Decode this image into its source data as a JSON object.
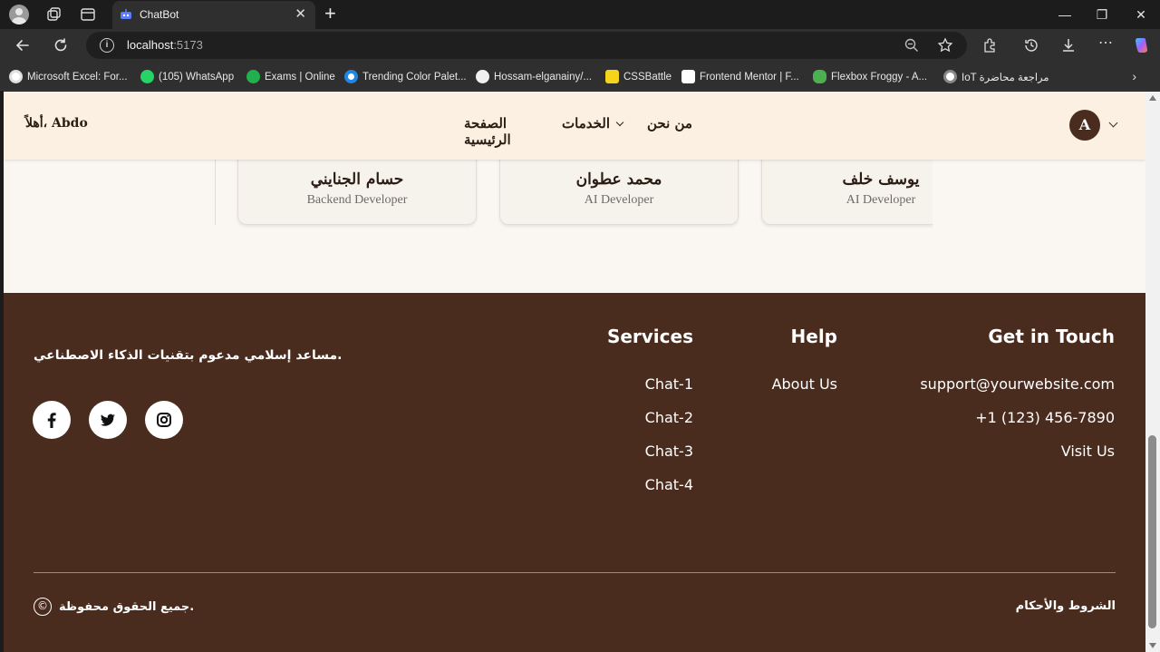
{
  "browser": {
    "tab_title": "ChatBot",
    "url_host": "localhost",
    "url_port": ":5173",
    "bookmarks": [
      "Microsoft Excel: For...",
      "(105) WhatsApp",
      "Exams | Online",
      "Trending Color Palet...",
      "Hossam-elganainy/...",
      "CSSBattle",
      "Frontend Mentor | F...",
      "Flexbox Froggy - A...",
      "IoT مراجعة محاضرة"
    ]
  },
  "navbar": {
    "greeting": "أهلاً، Abdo",
    "links": {
      "home": "الصفحة الرئيسية",
      "services": "الخدمات",
      "about": "من نحن"
    },
    "avatar_letter": "A"
  },
  "team": [
    {
      "name": "حسام الجنايني",
      "role": "Backend Developer"
    },
    {
      "name": "محمد عطوان",
      "role": "AI Developer"
    },
    {
      "name": "يوسف خلف",
      "role": "AI Developer"
    }
  ],
  "footer": {
    "tagline": "مساعد إسلامي مدعوم بتقنيات الذكاء الاصطناعي.",
    "social": [
      "facebook-icon",
      "twitter-icon",
      "instagram-icon"
    ],
    "services": {
      "title": "Services",
      "items": [
        "Chat-1",
        "Chat-2",
        "Chat-3",
        "Chat-4"
      ]
    },
    "help": {
      "title": "Help",
      "items": [
        "About Us"
      ]
    },
    "contact": {
      "title": "Get in Touch",
      "items": [
        "support@yourwebsite.com",
        "+1 (123) 456-7890",
        "Visit Us"
      ]
    },
    "copyright": "جميع الحقوق محفوظة.",
    "terms": "الشروط والأحكام"
  },
  "colors": {
    "footer_bg": "#4a2c1f",
    "navbar_bg": "#fcf0e2",
    "page_bg": "#faf6f1",
    "divider": "#a88a63"
  }
}
